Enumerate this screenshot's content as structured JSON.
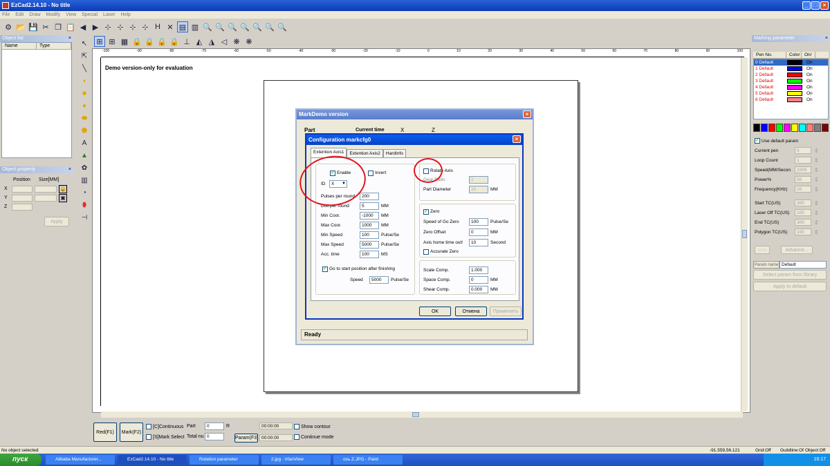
{
  "app": {
    "title": "EzCad2.14.10 - No title"
  },
  "menu": [
    "File",
    "Edit",
    "Draw",
    "Modify",
    "View",
    "Special",
    "Laser",
    "Help"
  ],
  "object_list": {
    "title": "Object list",
    "cols": [
      "Name",
      "Type"
    ]
  },
  "object_property": {
    "title": "Object property",
    "position": "Position",
    "size": "Size[MM]",
    "x": "X",
    "y": "Y",
    "z": "Z",
    "apply": "Apply"
  },
  "canvas": {
    "demo_text": "Demo version-only for evaluation",
    "ruler_ticks": [
      "-100",
      "-90",
      "-80",
      "-70",
      "-60",
      "-50",
      "-40",
      "-30",
      "-20",
      "-10",
      "0",
      "10",
      "20",
      "30",
      "40",
      "50",
      "60",
      "70",
      "80",
      "90",
      "100"
    ]
  },
  "bottom": {
    "red": "Red(F1)",
    "mark": "Mark(F2)",
    "continuous": "[C]Continuous",
    "mark_select": "[S]Mark Select",
    "part": "Part",
    "part_val": "0",
    "total": "Total nu",
    "total_val": "0",
    "r": "R",
    "time1": "00:00:00",
    "time2": "00:00:00",
    "param": "Param(F3)",
    "show_contour": "Show contour",
    "continue_mode": "Continue mode"
  },
  "marking": {
    "title": "Marking parameter",
    "cols": [
      "Pen No.",
      "Color",
      "On/"
    ],
    "pens": [
      {
        "name": "0 Default",
        "color": "#000000",
        "on": "On"
      },
      {
        "name": "1 Default",
        "color": "#0000ff",
        "on": "On"
      },
      {
        "name": "2 Default",
        "color": "#ff0000",
        "on": "On"
      },
      {
        "name": "3 Default",
        "color": "#00ff00",
        "on": "On"
      },
      {
        "name": "4 Default",
        "color": "#ff00ff",
        "on": "On"
      },
      {
        "name": "5 Default",
        "color": "#ffff00",
        "on": "On"
      },
      {
        "name": "6 Default",
        "color": "#ff8080",
        "on": "On"
      }
    ],
    "palette": [
      "#000000",
      "#0000ff",
      "#ff0000",
      "#00ff00",
      "#ff00ff",
      "#ffff00",
      "#00ffff",
      "#ff8080",
      "#808080",
      "#800000"
    ],
    "use_default": "Use default param",
    "params": [
      {
        "label": "Current pen",
        "value": "0"
      },
      {
        "label": "Loop Count",
        "value": "1"
      },
      {
        "label": "Speed(MM/Secon",
        "value": "1000"
      },
      {
        "label": "Power%",
        "value": "50"
      },
      {
        "label": "Frequency(KHz)",
        "value": "20"
      },
      {
        "label": "Start TC(US)",
        "value": "300"
      },
      {
        "label": "Laser Off TC(US)",
        "value": "100"
      },
      {
        "label": "End TC(US)",
        "value": "300"
      },
      {
        "label": "Polygon TC(US)",
        "value": "100"
      }
    ],
    "advance": "Advance...",
    "param_name": "Param name",
    "param_name_val": "Default",
    "select_lib": "Select param from library",
    "apply_default": "Apply to default"
  },
  "status": {
    "left": "No object selected",
    "coords": "-91.559,56.121",
    "grid": "Grid:Off",
    "guide": "Guildline:Of",
    "object": "Object:Off"
  },
  "taskbar": {
    "start": "пуск",
    "tasks": [
      "Alibaba Manufacturer...",
      "EzCad2.14.10 - No title",
      "Rotation parameter",
      "2.jpg - IrfanView",
      "ось Z.JPG - Paint"
    ],
    "time": "16:17"
  },
  "markdemo": {
    "title": "MarkDemo version",
    "part": "Part",
    "current_time": "Current time",
    "x": "X",
    "z": "Z",
    "ready": "Ready"
  },
  "config": {
    "title": "Configuration markcfg0",
    "tabs": [
      "Extention Axis1",
      "Extention Axis2",
      "HardInfo"
    ],
    "enable": "Enable",
    "invert": "Invert",
    "id": "ID",
    "id_val": "X",
    "left_fields": [
      {
        "label": "Pulses per round",
        "value": "200",
        "unit": ""
      },
      {
        "label": "Dist per round",
        "value": "5",
        "unit": "MM"
      },
      {
        "label": "Min Coor.",
        "value": "-1000",
        "unit": "MM"
      },
      {
        "label": "Max Coor.",
        "value": "1000",
        "unit": "MM"
      },
      {
        "label": "Min Speed",
        "value": "100",
        "unit": "Pulse/Se"
      },
      {
        "label": "Max Speed",
        "value": "5000",
        "unit": "Pulse/Se"
      },
      {
        "label": "Acc. time",
        "value": "100",
        "unit": "MS"
      }
    ],
    "goto_start": "Go to start position after finishing",
    "speed": "Speed",
    "speed_val": "5000",
    "speed_unit": "Pulse/Se",
    "rotate_axis": "Rotate Axis",
    "gear_ratio": "Gear Ratio",
    "gear_val": "1",
    "part_diameter": "Part Diameter",
    "part_diameter_val": "10",
    "mm": "MM",
    "zero": "Zero",
    "zero_fields": [
      {
        "label": "Speed of Go Zero",
        "value": "100",
        "unit": "Pulse/Se"
      },
      {
        "label": "Zero Offset",
        "value": "0",
        "unit": "MM"
      },
      {
        "label": "Axis home time out!",
        "value": "10",
        "unit": "Second"
      }
    ],
    "accurate_zero": "Accurate Zero",
    "comp_fields": [
      {
        "label": "Scale Comp.",
        "value": "1.000",
        "unit": ""
      },
      {
        "label": "Space Comp.",
        "value": "0",
        "unit": "MM"
      },
      {
        "label": "Shear Comp.",
        "value": "0.000",
        "unit": "MM"
      }
    ],
    "ok": "OK",
    "cancel": "Отмена",
    "apply": "Применить"
  },
  "annotation_color": "#e0141e"
}
